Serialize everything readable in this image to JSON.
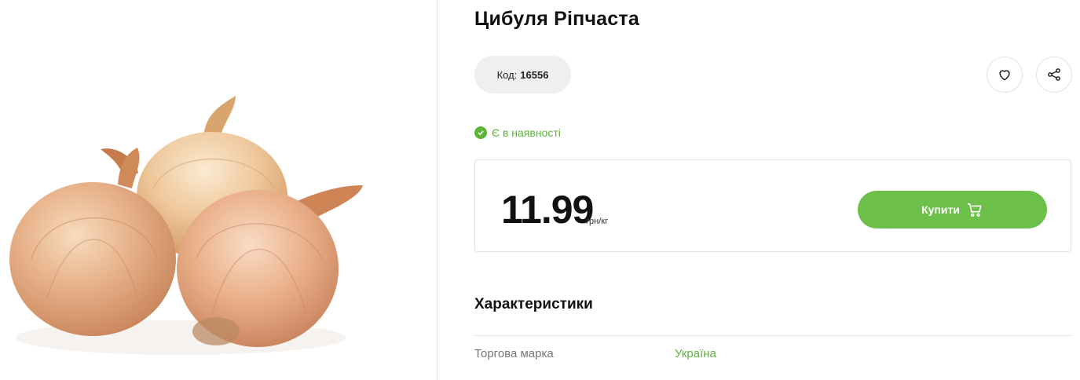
{
  "product": {
    "image_alt": "onions",
    "title": "Цибуля Ріпчаста",
    "code_label": "Код:",
    "code_value": "16556",
    "availability": "Є в наявності",
    "price": "11.99",
    "unit": "грн/кг",
    "buy_label": "Купити"
  },
  "actions": {
    "favorite_icon": "heart-icon",
    "share_icon": "share-icon",
    "cart_icon": "cart-icon"
  },
  "specs": {
    "title": "Характеристики",
    "rows": [
      {
        "label": "Торгова марка",
        "value": "Україна"
      }
    ]
  },
  "colors": {
    "accent_green": "#6cc04a",
    "stock_green": "#5cb338",
    "pill_gray": "#efefef"
  }
}
